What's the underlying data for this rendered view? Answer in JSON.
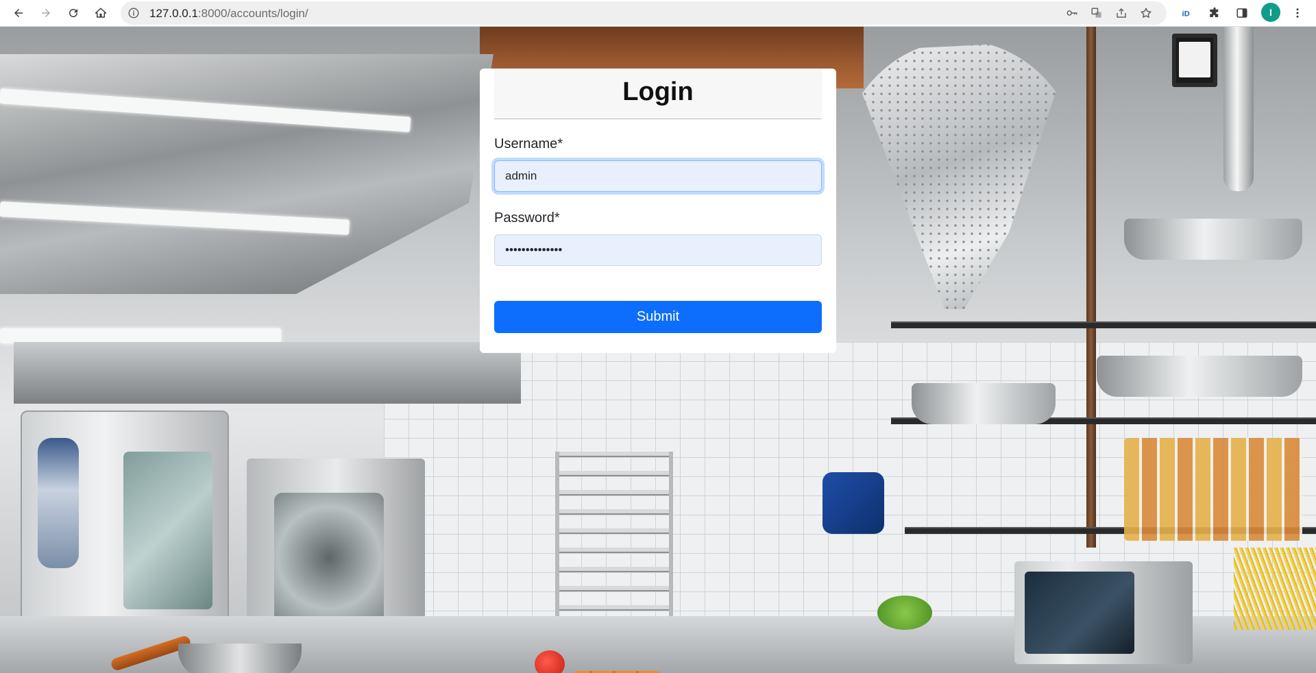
{
  "browser": {
    "url_host": "127.0.0.1",
    "url_path": ":8000/accounts/login/",
    "profile_initial": "I",
    "colors": {
      "profile_avatar": "#0f9d8a"
    },
    "nav_icons": [
      "back-icon",
      "forward-icon",
      "reload-icon",
      "home-icon"
    ],
    "omnibox_icons": [
      "key-icon",
      "translate-icon",
      "share-icon",
      "star-icon"
    ],
    "extension_icons": [
      "id-extension-icon",
      "puzzle-icon",
      "side-panel-icon",
      "kebab-menu-icon"
    ]
  },
  "login": {
    "title": "Login",
    "username_label": "Username*",
    "username_value": "admin",
    "password_label": "Password*",
    "password_value": "••••••••••••••",
    "submit_label": "Submit",
    "colors": {
      "submit": "#0d6efd",
      "input_autofill": "#e8f0fe",
      "card": "#ffffff",
      "header": "#f7f7f7"
    }
  },
  "background": {
    "description_icon": "kitchen-background-image"
  }
}
